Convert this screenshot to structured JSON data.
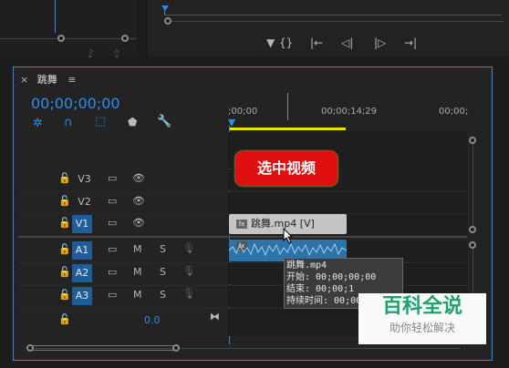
{
  "program_monitor": {
    "controls": [
      "▼",
      "{}",
      "|←",
      "◁|",
      "|▷",
      "→|"
    ]
  },
  "source_monitor": {
    "icons": [
      "compare-icon",
      "export-icon"
    ]
  },
  "timeline": {
    "panel_close": "×",
    "sequence_name": "跳舞",
    "menu_glyph": "≡",
    "playhead_timecode": "00;00;00;00",
    "ruler": {
      "start": ";00;00",
      "mid": "00;00;14;29",
      "end": "00;00;"
    },
    "tracks": {
      "video": [
        {
          "name": "V3",
          "selected": false
        },
        {
          "name": "V2",
          "selected": false
        },
        {
          "name": "V1",
          "selected": true
        }
      ],
      "audio": [
        {
          "name": "A1",
          "selected": true,
          "mute": "M",
          "solo": "S"
        },
        {
          "name": "A2",
          "selected": true,
          "mute": "M",
          "solo": "S"
        },
        {
          "name": "A3",
          "selected": true,
          "mute": "M",
          "solo": "S"
        }
      ],
      "master_volume": "0.0"
    },
    "video_clip": {
      "fx": "fx",
      "label": "跳舞.mp4 [V]"
    },
    "audio_clip": {
      "fx": "fx"
    },
    "tooltip": {
      "line1": "跳舞.mp4",
      "line2": "开始: 00;00;00;00",
      "line3": "结束: 00;00;1",
      "line4": "持续时间: 00;00;"
    }
  },
  "annotation": {
    "callout": "选中视频"
  },
  "watermark": {
    "title": "百科全说",
    "subtitle": "助你轻松解决"
  },
  "colors": {
    "accent": "#2d8ceb",
    "callout": "#e01010",
    "watermark_green": "#19a568"
  }
}
